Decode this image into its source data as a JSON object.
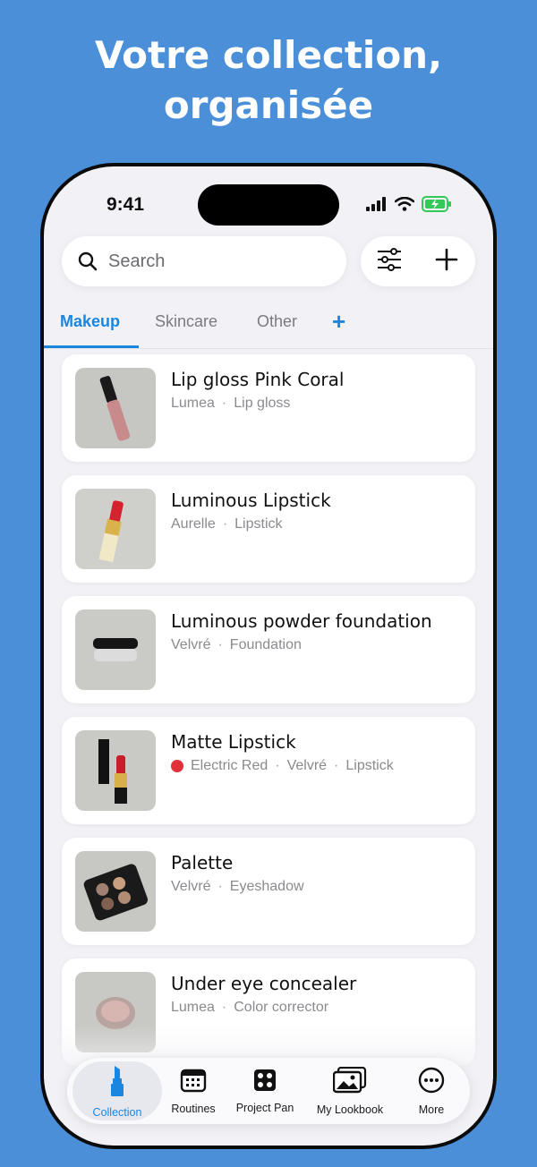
{
  "headline": {
    "line1": "Votre collection,",
    "line2": "organisée"
  },
  "status_bar": {
    "time": "9:41"
  },
  "search": {
    "placeholder": "Search",
    "icon": "search-icon"
  },
  "toolbar": {
    "filter_icon": "sliders-icon",
    "add_icon": "plus-icon"
  },
  "tabs": [
    {
      "label": "Makeup",
      "active": true
    },
    {
      "label": "Skincare",
      "active": false
    },
    {
      "label": "Other",
      "active": false
    }
  ],
  "tab_add": "+",
  "products": [
    {
      "name": "Lip gloss Pink Coral",
      "brand": "Lumea",
      "category": "Lip gloss",
      "shade": ""
    },
    {
      "name": "Luminous Lipstick",
      "brand": "Aurelle",
      "category": "Lipstick",
      "shade": ""
    },
    {
      "name": "Luminous powder foundation",
      "brand": "Velvré",
      "category": "Foundation",
      "shade": ""
    },
    {
      "name": "Matte Lipstick",
      "shade": "Electric Red",
      "shade_color": "#e0303a",
      "brand": "Velvré",
      "category": "Lipstick"
    },
    {
      "name": "Palette",
      "brand": "Velvré",
      "category": "Eyeshadow",
      "shade": ""
    },
    {
      "name": "Under eye concealer",
      "brand": "Lumea",
      "category": "Color corrector",
      "shade": ""
    }
  ],
  "separator": "·",
  "bottom_nav": [
    {
      "label": "Collection",
      "icon": "lipstick-icon",
      "active": true
    },
    {
      "label": "Routines",
      "icon": "calendar-icon",
      "active": false
    },
    {
      "label": "Project Pan",
      "icon": "palette-icon",
      "active": false
    },
    {
      "label": "My Lookbook",
      "icon": "photos-icon",
      "active": false
    },
    {
      "label": "More",
      "icon": "more-icon",
      "active": false
    }
  ],
  "colors": {
    "background": "#4a8fd8",
    "accent": "#1a86e0",
    "screen": "#f2f2f6"
  }
}
